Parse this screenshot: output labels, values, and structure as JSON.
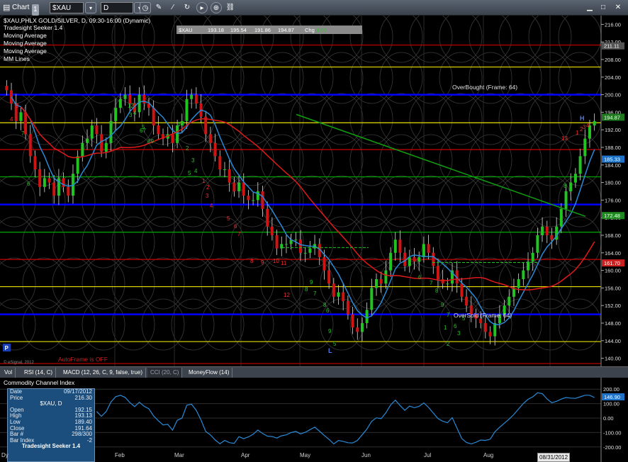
{
  "toolbar": {
    "title": "Chart",
    "title_badge": "1",
    "symbol": "$XAU",
    "interval": "D"
  },
  "chart": {
    "header": "$XAU,PHLX GOLD/SILVER, D, 09:30-16:00 (Dynamic)",
    "study_labels": [
      "Tradesight Seeker 1.4",
      "Moving Average",
      "Moving Average",
      "Moving Average",
      "MM Lines"
    ],
    "quote_box": {
      "symbol": "$XAU",
      "last": "193.18",
      "high": "195.54",
      "low": "191.86",
      "close": "194.87",
      "chg_label": "Chg",
      "chg": "1.69"
    },
    "overbought_label": "OverBought (Frame: 64)",
    "oversold_label": "OverSold (Frame: 64)",
    "autoframe_label": "AutoFrame is OFF",
    "copyright": "© eSignal, 2012",
    "corner_label": "P",
    "high_marker": "H",
    "low_marker": "L",
    "price_axis": {
      "ticks": [
        "216.00",
        "212.00",
        "208.00",
        "204.00",
        "200.00",
        "196.00",
        "192.00",
        "188.00",
        "184.00",
        "180.00",
        "176.00",
        "172.00",
        "168.00",
        "164.00",
        "160.00",
        "156.00",
        "152.00",
        "148.00",
        "144.00",
        "140.00"
      ],
      "tags": [
        {
          "text": "211.11",
          "color": "#555555"
        },
        {
          "text": "194.87",
          "color": "#1f7a1f"
        },
        {
          "text": "185.33",
          "color": "#1e73c8"
        },
        {
          "text": "172.48",
          "color": "#1f8a1f"
        },
        {
          "text": "161.70",
          "color": "#cc1f1f"
        }
      ]
    },
    "seeker_counts_red": [
      "3",
      "4",
      "1",
      "2",
      "3",
      "4",
      "5",
      "6",
      "7",
      "8",
      "9",
      "10",
      "11",
      "12",
      "13",
      "1",
      "2",
      "3",
      "4"
    ],
    "seeker_counts_green": [
      "12",
      "3",
      "4",
      "5",
      "67",
      "89",
      "1",
      "2",
      "3",
      "4",
      "5",
      "6",
      "7",
      "8",
      "9",
      "7",
      "8",
      "6",
      "9",
      "5",
      "6",
      "7",
      "8",
      "9",
      "1",
      "2",
      "3",
      "5",
      "6",
      "7",
      "8"
    ]
  },
  "tabs": [
    {
      "label": "Vol"
    },
    {
      "label": "RSI (14, C)"
    },
    {
      "label": "MACD (12, 26, C, 9, false, true)"
    },
    {
      "label": "CCI (20, C)"
    },
    {
      "label": "MoneyFlow (14)"
    }
  ],
  "cci": {
    "title": "Commodity Channel Index",
    "ticks": [
      "200.00",
      "100.00",
      "0.00",
      "-100.00",
      "-200.00"
    ],
    "current_tag": "146.90"
  },
  "data_window": {
    "rows": [
      {
        "label": "Date",
        "value": "09/17/2012"
      },
      {
        "label": "Price",
        "value": "216.30"
      }
    ],
    "symbol": "$XAU, D",
    "ohlc": [
      {
        "label": "Open",
        "value": "192.15"
      },
      {
        "label": "High",
        "value": "193.13"
      },
      {
        "label": "Low",
        "value": "189.40"
      },
      {
        "label": "Close",
        "value": "191.64"
      },
      {
        "label": "Bar #",
        "value": "298/300"
      },
      {
        "label": "Bar Index",
        "value": "-2"
      }
    ],
    "footer": "Tradesight Seeker 1.4"
  },
  "x_axis": {
    "labels": [
      "Dy",
      "Feb",
      "Mar",
      "Apr",
      "May",
      "Jun",
      "Jul",
      "Aug"
    ],
    "date_box": "08/31/2012"
  },
  "chart_data": {
    "type": "candlestick",
    "symbol": "$XAU",
    "price_axis_range": [
      138,
      218
    ],
    "horizontal_lines": [
      {
        "price": 211.3,
        "color": "#cc0000"
      },
      {
        "price": 206.3,
        "color": "#e8e000"
      },
      {
        "price": 200.0,
        "color": "#0000ff"
      },
      {
        "price": 193.6,
        "color": "#e8e000"
      },
      {
        "price": 187.5,
        "color": "#cc0000"
      },
      {
        "price": 181.3,
        "color": "#00aa00"
      },
      {
        "price": 175.0,
        "color": "#0000ff"
      },
      {
        "price": 168.7,
        "color": "#00aa00"
      },
      {
        "price": 162.5,
        "color": "#cc0000"
      },
      {
        "price": 156.3,
        "color": "#e8e000"
      },
      {
        "price": 150.0,
        "color": "#0000ff"
      },
      {
        "price": 143.8,
        "color": "#e8e000"
      },
      {
        "price": 138.8,
        "color": "#cc0000"
      }
    ],
    "close_series": [
      201,
      198,
      194,
      196,
      191,
      186,
      183,
      179,
      181,
      180,
      177,
      181,
      179,
      177,
      182,
      186,
      189,
      190,
      193,
      191,
      187,
      189,
      194,
      197,
      199,
      200,
      198,
      196,
      200,
      198,
      197,
      193,
      191,
      190,
      191,
      189,
      193,
      194,
      199,
      200,
      198,
      195,
      191,
      189,
      186,
      183,
      183,
      180,
      178,
      180,
      177,
      176,
      176,
      178,
      174,
      170,
      168,
      165,
      166,
      166,
      167,
      167,
      164,
      164,
      165,
      166,
      163,
      160,
      157,
      154,
      155,
      153,
      150,
      147,
      146,
      148,
      151,
      156,
      158,
      157,
      160,
      164,
      167,
      164,
      161,
      163,
      162,
      163,
      166,
      164,
      161,
      158,
      157,
      157,
      160,
      157,
      154,
      152,
      150,
      149,
      148,
      146,
      145,
      148,
      150,
      152,
      154,
      156,
      158,
      160,
      162,
      164,
      168,
      170,
      168,
      167,
      170,
      174,
      178,
      180,
      182,
      186,
      190,
      193,
      194
    ]
  }
}
